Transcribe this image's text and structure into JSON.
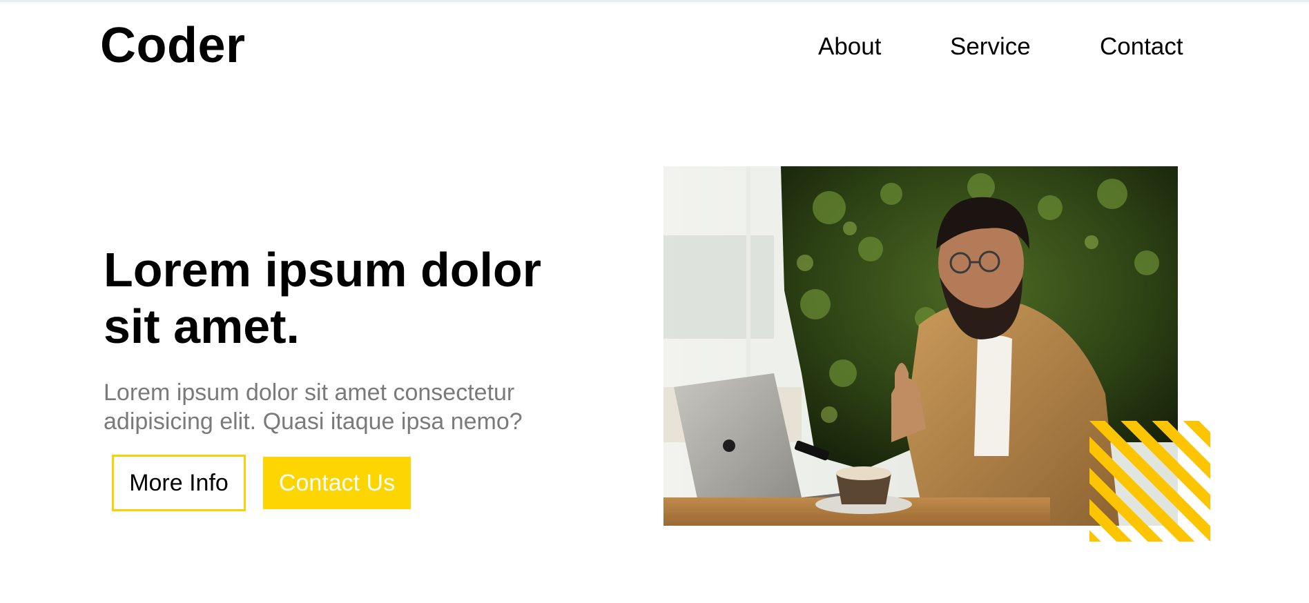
{
  "header": {
    "logo": "Coder",
    "nav": [
      {
        "label": "About"
      },
      {
        "label": "Service"
      },
      {
        "label": "Contact"
      }
    ]
  },
  "hero": {
    "title_line1": "Lorem ipsum dolor",
    "title_line2": "sit amet.",
    "description_line1": "Lorem ipsum dolor sit amet consectetur",
    "description_line2": "adipisicing elit. Quasi itaque ipsa nemo?",
    "more_info_label": "More Info",
    "contact_us_label": "Contact Us"
  },
  "colors": {
    "accent": "#fdd500",
    "text": "#000000",
    "muted": "#7a7a7a"
  },
  "icons": {
    "hero_photo": "man-with-laptop-photo",
    "decor": "yellow-diagonal-stripes"
  }
}
